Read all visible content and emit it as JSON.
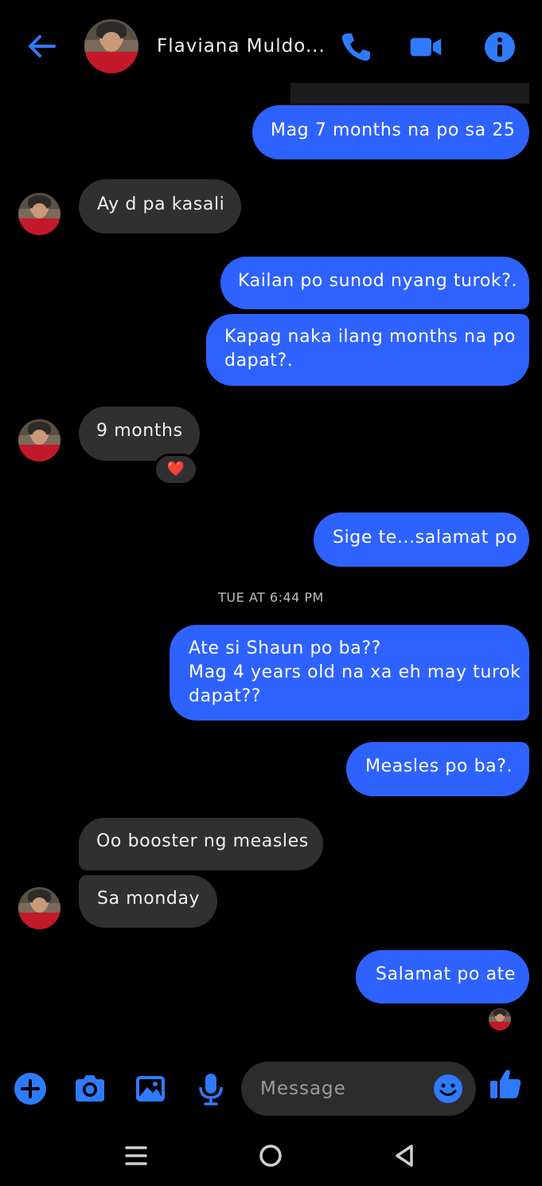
{
  "header": {
    "contact_name": "Flaviana Muldo...",
    "icons": {
      "back": "arrow-left-icon",
      "call": "phone-icon",
      "video": "video-camera-icon",
      "info": "info-icon"
    }
  },
  "colors": {
    "accent": "#2e62ff",
    "icon_blue": "#2f7bff",
    "incoming_bubble": "#303030",
    "background": "#000000"
  },
  "messages": [
    {
      "from": "me",
      "text": "Mag 7 months na po sa 25"
    },
    {
      "from": "them",
      "text": "Ay d pa kasali"
    },
    {
      "from": "me",
      "text": "Kailan po sunod nyang turok?."
    },
    {
      "from": "me",
      "text": "Kapag naka ilang months na po\ndapat?."
    },
    {
      "from": "them",
      "text": "9 months",
      "reaction": "❤️"
    },
    {
      "from": "me",
      "text": "Sige te...salamat po"
    },
    {
      "from": "me",
      "text": "Ate si Shaun po ba??\nMag 4 years old na xa eh may turok\ndapat??"
    },
    {
      "from": "me",
      "text": "Measles po ba?."
    },
    {
      "from": "them",
      "text": "Oo booster ng measles"
    },
    {
      "from": "them",
      "text": "Sa monday"
    },
    {
      "from": "me",
      "text": "Salamat po ate"
    }
  ],
  "timestamp": "TUE AT 6:44 PM",
  "composer": {
    "placeholder": "Message",
    "icons": [
      "plus-icon",
      "camera-icon",
      "gallery-icon",
      "microphone-icon",
      "emoji-icon",
      "thumbs-up-icon"
    ]
  },
  "navbar": {
    "icons": [
      "recent-apps-icon",
      "home-icon",
      "back-triangle-icon"
    ]
  }
}
